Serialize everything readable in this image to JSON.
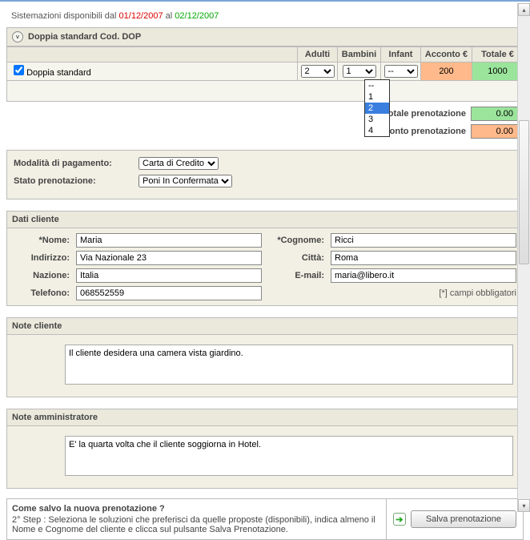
{
  "avail": {
    "label": "Sistemazioni disponibili dal",
    "date1": "01/12/2007",
    "sep": "al",
    "date2": "02/12/2007"
  },
  "room": {
    "title": "Doppia standard Cod. DOP",
    "name": "Doppia standard",
    "headers": {
      "adults": "Adulti",
      "children": "Bambini",
      "infant": "Infant",
      "deposit": "Acconto €",
      "total": "Totale €"
    },
    "values": {
      "adults": "2",
      "children": "1",
      "infant": "--",
      "deposit": "200",
      "total": "1000"
    },
    "dropdown_options": [
      "--",
      "1",
      "2",
      "3",
      "4"
    ],
    "dropdown_selected": "2"
  },
  "totals": {
    "total_label": "Totale prenotazione",
    "total_value": "0.00",
    "deposit_label": "Acconto prenotazione",
    "deposit_value": "0.00"
  },
  "payment": {
    "label": "Modalità di pagamento:",
    "value": "Carta di Credito"
  },
  "status": {
    "label": "Stato prenotazione:",
    "value": "Poni In Confermata"
  },
  "client": {
    "header": "Dati cliente",
    "labels": {
      "nome": "*Nome:",
      "cognome": "*Cognome:",
      "indirizzo": "Indirizzo:",
      "citta": "Città:",
      "nazione": "Nazione:",
      "email": "E-mail:",
      "telefono": "Telefono:"
    },
    "values": {
      "nome": "Maria",
      "cognome": "Ricci",
      "indirizzo": "Via Nazionale 23",
      "citta": "Roma",
      "nazione": "Italia",
      "email": "maria@libero.it",
      "telefono": "068552559"
    },
    "mandatory": "[*] campi obbligatori"
  },
  "notes_client": {
    "header": "Note cliente",
    "text": "Il cliente desidera una camera vista giardino."
  },
  "notes_admin": {
    "header": "Note amministratore",
    "text": "E' la quarta volta che il cliente soggiorna in Hotel."
  },
  "save": {
    "question": "Come salvo la nuova prenotazione ?",
    "help": "2° Step : Seleziona le soluzioni che preferisci da quelle proposte (disponibili), indica almeno il Nome e Cognome del cliente e clicca sul pulsante Salva Prenotazione.",
    "button": "Salva prenotazione"
  }
}
